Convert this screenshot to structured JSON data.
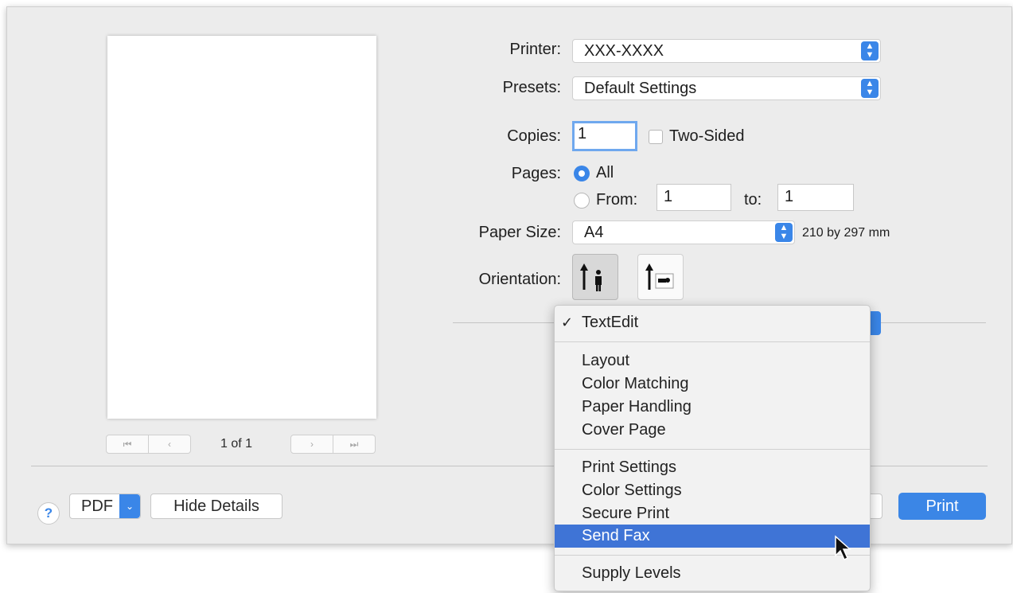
{
  "preview": {
    "page_indicator": "1 of 1"
  },
  "nav": {
    "first": "⏮",
    "prev": "‹",
    "next": "›",
    "last": "⏭"
  },
  "printer": {
    "label": "Printer:",
    "value": "XXX-XXXX"
  },
  "presets": {
    "label": "Presets:",
    "value": "Default Settings"
  },
  "copies": {
    "label": "Copies:",
    "value": "1",
    "two_sided": "Two-Sided"
  },
  "pages": {
    "label": "Pages:",
    "all": "All",
    "from_label": "From:",
    "from_value": "1",
    "to_label": "to:",
    "to_value": "1"
  },
  "paper_size": {
    "label": "Paper Size:",
    "value": "A4",
    "dimensions": "210 by 297 mm"
  },
  "orientation": {
    "label": "Orientation:"
  },
  "menu": {
    "checked": "TextEdit",
    "group1": [
      "Layout",
      "Color Matching",
      "Paper Handling",
      "Cover Page"
    ],
    "group2": [
      "Print Settings",
      "Color Settings",
      "Secure Print",
      "Send Fax"
    ],
    "group3": [
      "Supply Levels"
    ],
    "highlighted": "Send Fax"
  },
  "footer": {
    "help": "?",
    "pdf": "PDF",
    "hide_details": "Hide Details",
    "print": "Print"
  },
  "colors": {
    "accent": "#3a86e8",
    "highlight": "#3f74d6"
  }
}
